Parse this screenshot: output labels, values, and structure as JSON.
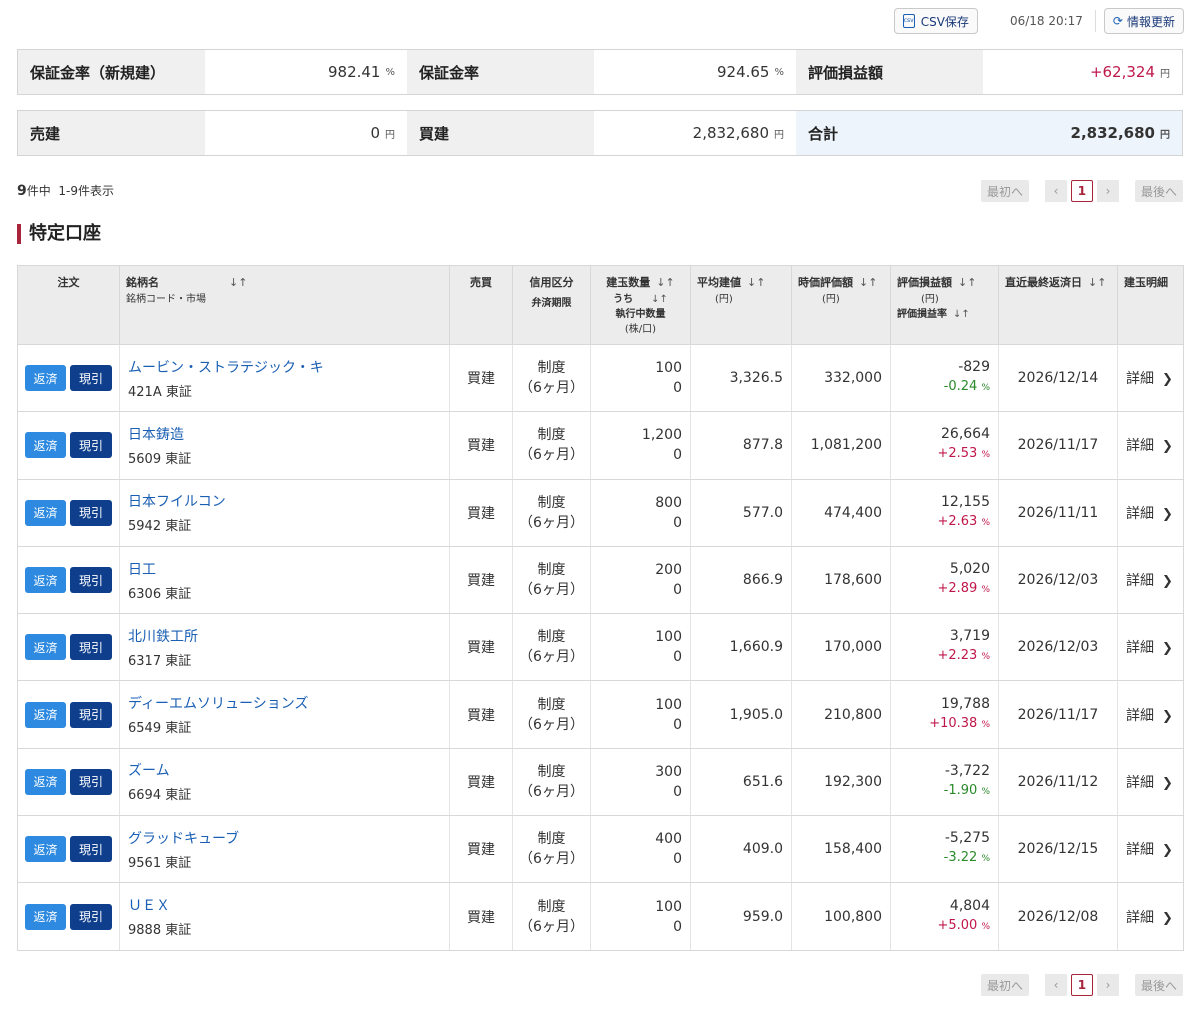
{
  "toolbar": {
    "csv_label": "CSV保存",
    "csv_icon": "csv-file-icon",
    "timestamp": "06/18 20:17",
    "refresh_label": "情報更新",
    "refresh_icon": "refresh-icon"
  },
  "summary_row1": {
    "margin_rate_new_label": "保証金率（新規建）",
    "margin_rate_new_value": "982.41",
    "margin_rate_label": "保証金率",
    "margin_rate_value": "924.65",
    "pct_unit": "%",
    "eval_pl_label": "評価損益額",
    "eval_pl_value": "+62,324",
    "yen_unit": "円"
  },
  "summary_row2": {
    "sell_label": "売建",
    "sell_value": "0",
    "buy_label": "買建",
    "buy_value": "2,832,680",
    "total_label": "合計",
    "total_value": "2,832,680",
    "yen_unit": "円"
  },
  "listing": {
    "count_total": "9",
    "count_suffix": "件中",
    "range": "1-9件表示"
  },
  "pager": {
    "first": "最初へ",
    "prev": "‹",
    "current": "1",
    "next": "›",
    "last": "最後へ"
  },
  "section_title": "特定口座",
  "table": {
    "headers": {
      "order": "注文",
      "name": "銘柄名",
      "name_sub": "銘柄コード・市場",
      "side": "売買",
      "credit": "信用区分",
      "credit_sub": "弁済期限",
      "qty": "建玉数量",
      "qty_sub1": "うち",
      "qty_sub2": "執行中数量",
      "qty_unit": "(株/口)",
      "avg": "平均建値",
      "avg_unit": "(円)",
      "mkt": "時価評価額",
      "mkt_unit": "(円)",
      "pl": "評価損益額",
      "pl_unit": "(円)",
      "pl_sub": "評価損益率",
      "date": "直近最終返済日",
      "detail": "建玉明細",
      "sort_icon": "↓↑"
    },
    "buttons": {
      "hensai": "返済",
      "genbiki": "現引",
      "detail": "詳細"
    },
    "rows": [
      {
        "name": "ムービン・ストラテジック・キ",
        "code": "421A 東証",
        "side": "買建",
        "kubun1": "制度",
        "kubun2": "（6ヶ月）",
        "qty": "100",
        "exec": "0",
        "avg": "3,326.5",
        "mkt": "332,000",
        "pl": "-829",
        "plpct": "-0.24",
        "date": "2026/12/14",
        "sign": "neg"
      },
      {
        "name": "日本鋳造",
        "code": "5609 東証",
        "side": "買建",
        "kubun1": "制度",
        "kubun2": "（6ヶ月）",
        "qty": "1,200",
        "exec": "0",
        "avg": "877.8",
        "mkt": "1,081,200",
        "pl": "26,664",
        "plpct": "+2.53",
        "date": "2026/11/17",
        "sign": "pos"
      },
      {
        "name": "日本フイルコン",
        "code": "5942 東証",
        "side": "買建",
        "kubun1": "制度",
        "kubun2": "（6ヶ月）",
        "qty": "800",
        "exec": "0",
        "avg": "577.0",
        "mkt": "474,400",
        "pl": "12,155",
        "plpct": "+2.63",
        "date": "2026/11/11",
        "sign": "pos"
      },
      {
        "name": "日工",
        "code": "6306 東証",
        "side": "買建",
        "kubun1": "制度",
        "kubun2": "（6ヶ月）",
        "qty": "200",
        "exec": "0",
        "avg": "866.9",
        "mkt": "178,600",
        "pl": "5,020",
        "plpct": "+2.89",
        "date": "2026/12/03",
        "sign": "pos"
      },
      {
        "name": "北川鉄工所",
        "code": "6317 東証",
        "side": "買建",
        "kubun1": "制度",
        "kubun2": "（6ヶ月）",
        "qty": "100",
        "exec": "0",
        "avg": "1,660.9",
        "mkt": "170,000",
        "pl": "3,719",
        "plpct": "+2.23",
        "date": "2026/12/03",
        "sign": "pos"
      },
      {
        "name": "ディーエムソリューションズ",
        "code": "6549 東証",
        "side": "買建",
        "kubun1": "制度",
        "kubun2": "（6ヶ月）",
        "qty": "100",
        "exec": "0",
        "avg": "1,905.0",
        "mkt": "210,800",
        "pl": "19,788",
        "plpct": "+10.38",
        "date": "2026/11/17",
        "sign": "pos"
      },
      {
        "name": "ズーム",
        "code": "6694 東証",
        "side": "買建",
        "kubun1": "制度",
        "kubun2": "（6ヶ月）",
        "qty": "300",
        "exec": "0",
        "avg": "651.6",
        "mkt": "192,300",
        "pl": "-3,722",
        "plpct": "-1.90",
        "date": "2026/11/12",
        "sign": "neg"
      },
      {
        "name": "グラッドキューブ",
        "code": "9561 東証",
        "side": "買建",
        "kubun1": "制度",
        "kubun2": "（6ヶ月）",
        "qty": "400",
        "exec": "0",
        "avg": "409.0",
        "mkt": "158,400",
        "pl": "-5,275",
        "plpct": "-3.22",
        "date": "2026/12/15",
        "sign": "neg"
      },
      {
        "name": "ＵＥＸ",
        "code": "9888 東証",
        "side": "買建",
        "kubun1": "制度",
        "kubun2": "（6ヶ月）",
        "qty": "100",
        "exec": "0",
        "avg": "959.0",
        "mkt": "100,800",
        "pl": "4,804",
        "plpct": "+5.00",
        "date": "2026/12/08",
        "sign": "pos"
      }
    ]
  },
  "colors": {
    "positive": "#c0174b",
    "negative": "#2a8a2a",
    "accent": "#a8253c",
    "link": "#1a5fb4",
    "hensai_button": "#2d8ae0",
    "genbiki_button": "#0f3f8c"
  }
}
